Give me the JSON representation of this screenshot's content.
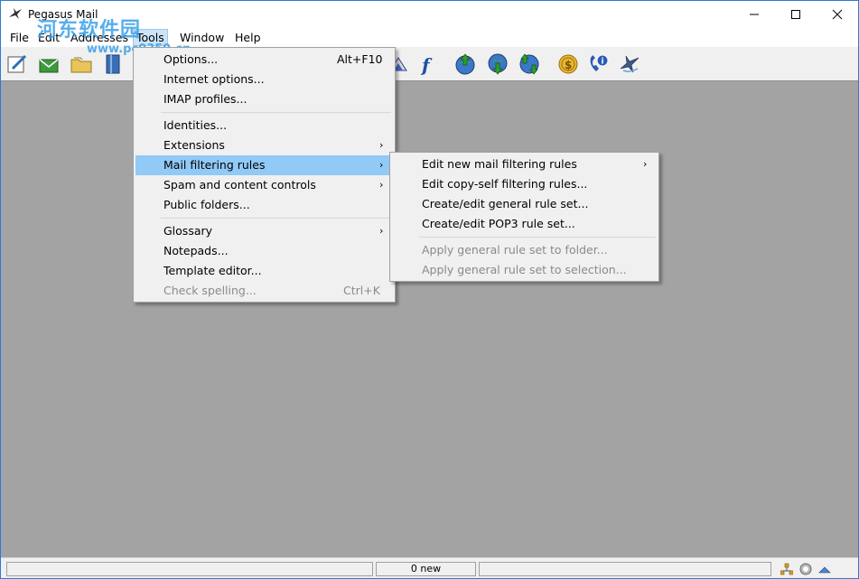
{
  "window": {
    "title": "Pegasus Mail"
  },
  "watermark": {
    "text": "河东软件园",
    "url": "www.pc0359.cn"
  },
  "menubar": [
    {
      "label": "File"
    },
    {
      "label": "Edit"
    },
    {
      "label": "Addresses"
    },
    {
      "label": "Tools"
    },
    {
      "label": "Window"
    },
    {
      "label": "Help"
    }
  ],
  "tools_menu": {
    "options": {
      "label": "Options...",
      "shortcut": "Alt+F10"
    },
    "internet_options": {
      "label": "Internet options..."
    },
    "imap_profiles": {
      "label": "IMAP profiles..."
    },
    "identities": {
      "label": "Identities..."
    },
    "extensions": {
      "label": "Extensions",
      "arrow": "›"
    },
    "mail_filtering_rules": {
      "label": "Mail filtering rules",
      "arrow": "›"
    },
    "spam_controls": {
      "label": "Spam and content controls",
      "arrow": "›"
    },
    "public_folders": {
      "label": "Public folders..."
    },
    "glossary": {
      "label": "Glossary",
      "arrow": "›"
    },
    "notepads": {
      "label": "Notepads..."
    },
    "template_editor": {
      "label": "Template editor..."
    },
    "check_spelling": {
      "label": "Check spelling...",
      "shortcut": "Ctrl+K"
    }
  },
  "filter_submenu": {
    "edit_new": {
      "label": "Edit new mail filtering rules",
      "arrow": "›"
    },
    "edit_copy_self": {
      "label": "Edit copy-self filtering rules..."
    },
    "create_general": {
      "label": "Create/edit general rule set..."
    },
    "create_pop3": {
      "label": "Create/edit POP3 rule set..."
    },
    "apply_folder": {
      "label": "Apply general rule set to folder..."
    },
    "apply_selection": {
      "label": "Apply general rule set to selection..."
    }
  },
  "statusbar": {
    "new_count": "0 new"
  },
  "colors": {
    "accent": "#91c9f7",
    "workspace": "#a3a3a3",
    "menu_bg": "#f0f0f0"
  }
}
